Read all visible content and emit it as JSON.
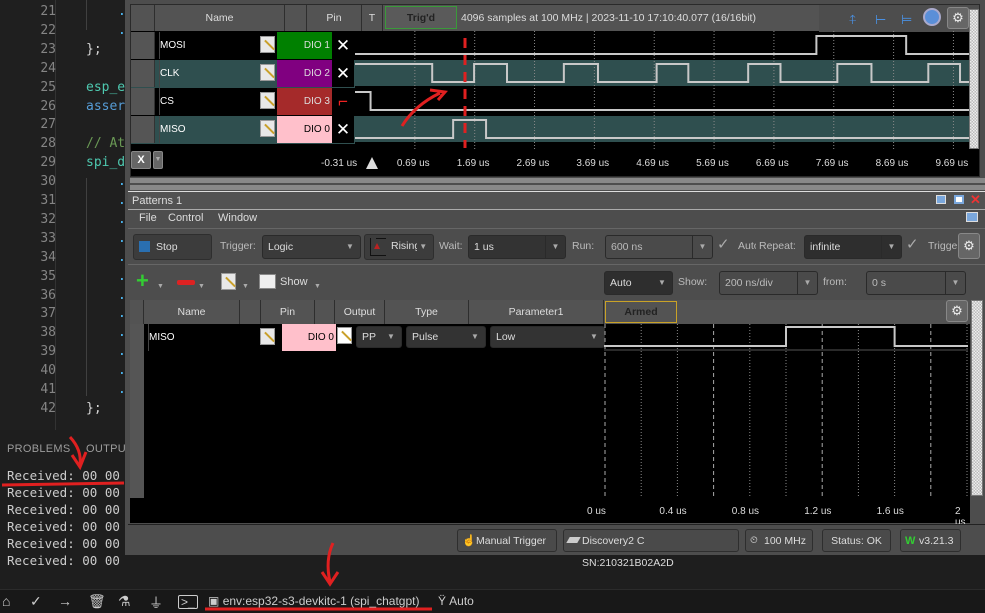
{
  "editor": {
    "lines": [
      {
        "num": "21",
        "text": "."
      },
      {
        "num": "22",
        "text": "."
      },
      {
        "num": "23",
        "text": "};"
      },
      {
        "num": "24",
        "text": ""
      },
      {
        "num": "25",
        "text": "esp_e"
      },
      {
        "num": "26",
        "text": "asser"
      },
      {
        "num": "27",
        "text": ""
      },
      {
        "num": "28",
        "text": "// At"
      },
      {
        "num": "29",
        "text": "spi_d"
      },
      {
        "num": "30",
        "text": "."
      },
      {
        "num": "31",
        "text": "."
      },
      {
        "num": "32",
        "text": "."
      },
      {
        "num": "33",
        "text": "."
      },
      {
        "num": "34",
        "text": "."
      },
      {
        "num": "35",
        "text": "."
      },
      {
        "num": "36",
        "text": "."
      },
      {
        "num": "37",
        "text": "."
      },
      {
        "num": "38",
        "text": "."
      },
      {
        "num": "39",
        "text": "."
      },
      {
        "num": "40",
        "text": "."
      },
      {
        "num": "41",
        "text": "."
      },
      {
        "num": "42",
        "text": "};"
      }
    ]
  },
  "panel": {
    "tabs": [
      "PROBLEMS",
      "OUTPUT"
    ],
    "terminal_lines": [
      "Received: 00 00",
      "Received: 00 00",
      "Received: 00 00",
      "Received: 00 00",
      "Received: 00 00",
      "Received: 00 00"
    ]
  },
  "statusbar": {
    "env_label": "env:esp32-s3-devkitc-1 (spi_chatgpt)",
    "auto_label": "Auto"
  },
  "logic": {
    "headers": {
      "name": "Name",
      "pin": "Pin",
      "t": "T",
      "trig_state": "Trig'd"
    },
    "info": "4096 samples at 100 MHz | 2023-11-10 17:10:40.077 (16/16bit)",
    "channels": [
      {
        "name": "MOSI",
        "pin": "DIO 1",
        "pin_color": "#008000",
        "trigger": "X"
      },
      {
        "name": "CLK",
        "pin": "DIO 2",
        "pin_color": "#800080",
        "trigger": "X"
      },
      {
        "name": "CS",
        "pin": "DIO 3",
        "pin_color": "#a52a2a",
        "trigger": "falling"
      },
      {
        "name": "MISO",
        "pin": "DIO 0",
        "pin_color": "#ffc0cb",
        "trigger": "X"
      }
    ],
    "time_ticks": [
      "-0.31 us",
      "0.69 us",
      "1.69 us",
      "2.69 us",
      "3.69 us",
      "4.69 us",
      "5.69 us",
      "6.69 us",
      "7.69 us",
      "8.69 us",
      "9.69 us"
    ],
    "x_button": "X"
  },
  "patterns": {
    "title": "Patterns 1",
    "menu": [
      "File",
      "Control",
      "Window"
    ],
    "toolbar": {
      "stop_label": "Stop",
      "trigger_label": "Trigger:",
      "trigger_value": "Logic",
      "edge_value": "Rising",
      "wait_label": "Wait:",
      "wait_value": "1 us",
      "run_label": "Run:",
      "run_value": "600 ns",
      "auto_label": "Auto",
      "repeat_label": "Repeat:",
      "repeat_value": "infinite",
      "trigger_repeat_label": "Trigger"
    },
    "toolbar2": {
      "show_label": "Show",
      "mode_value": "Auto",
      "show_div_label": "Show:",
      "show_div_value": "200 ns/div",
      "from_label": "from:",
      "from_value": "0 s"
    },
    "headers": {
      "name": "Name",
      "pin": "Pin",
      "output": "Output",
      "type": "Type",
      "param1": "Parameter1",
      "state": "Armed"
    },
    "rows": [
      {
        "name": "MISO",
        "pin": "DIO 0",
        "pin_color": "#ffc0cb",
        "output": "PP",
        "type": "Pulse",
        "param1": "Low"
      }
    ],
    "time_ticks": [
      "0 us",
      "0.4 us",
      "0.8 us",
      "1.2 us",
      "1.6 us",
      "2 us"
    ]
  },
  "wf_status": {
    "manual_trigger": "Manual Trigger",
    "device": "Discovery2 C SN:210321B02A2D",
    "freq": "100 MHz",
    "status": "Status: OK",
    "version": "v3.21.3"
  }
}
